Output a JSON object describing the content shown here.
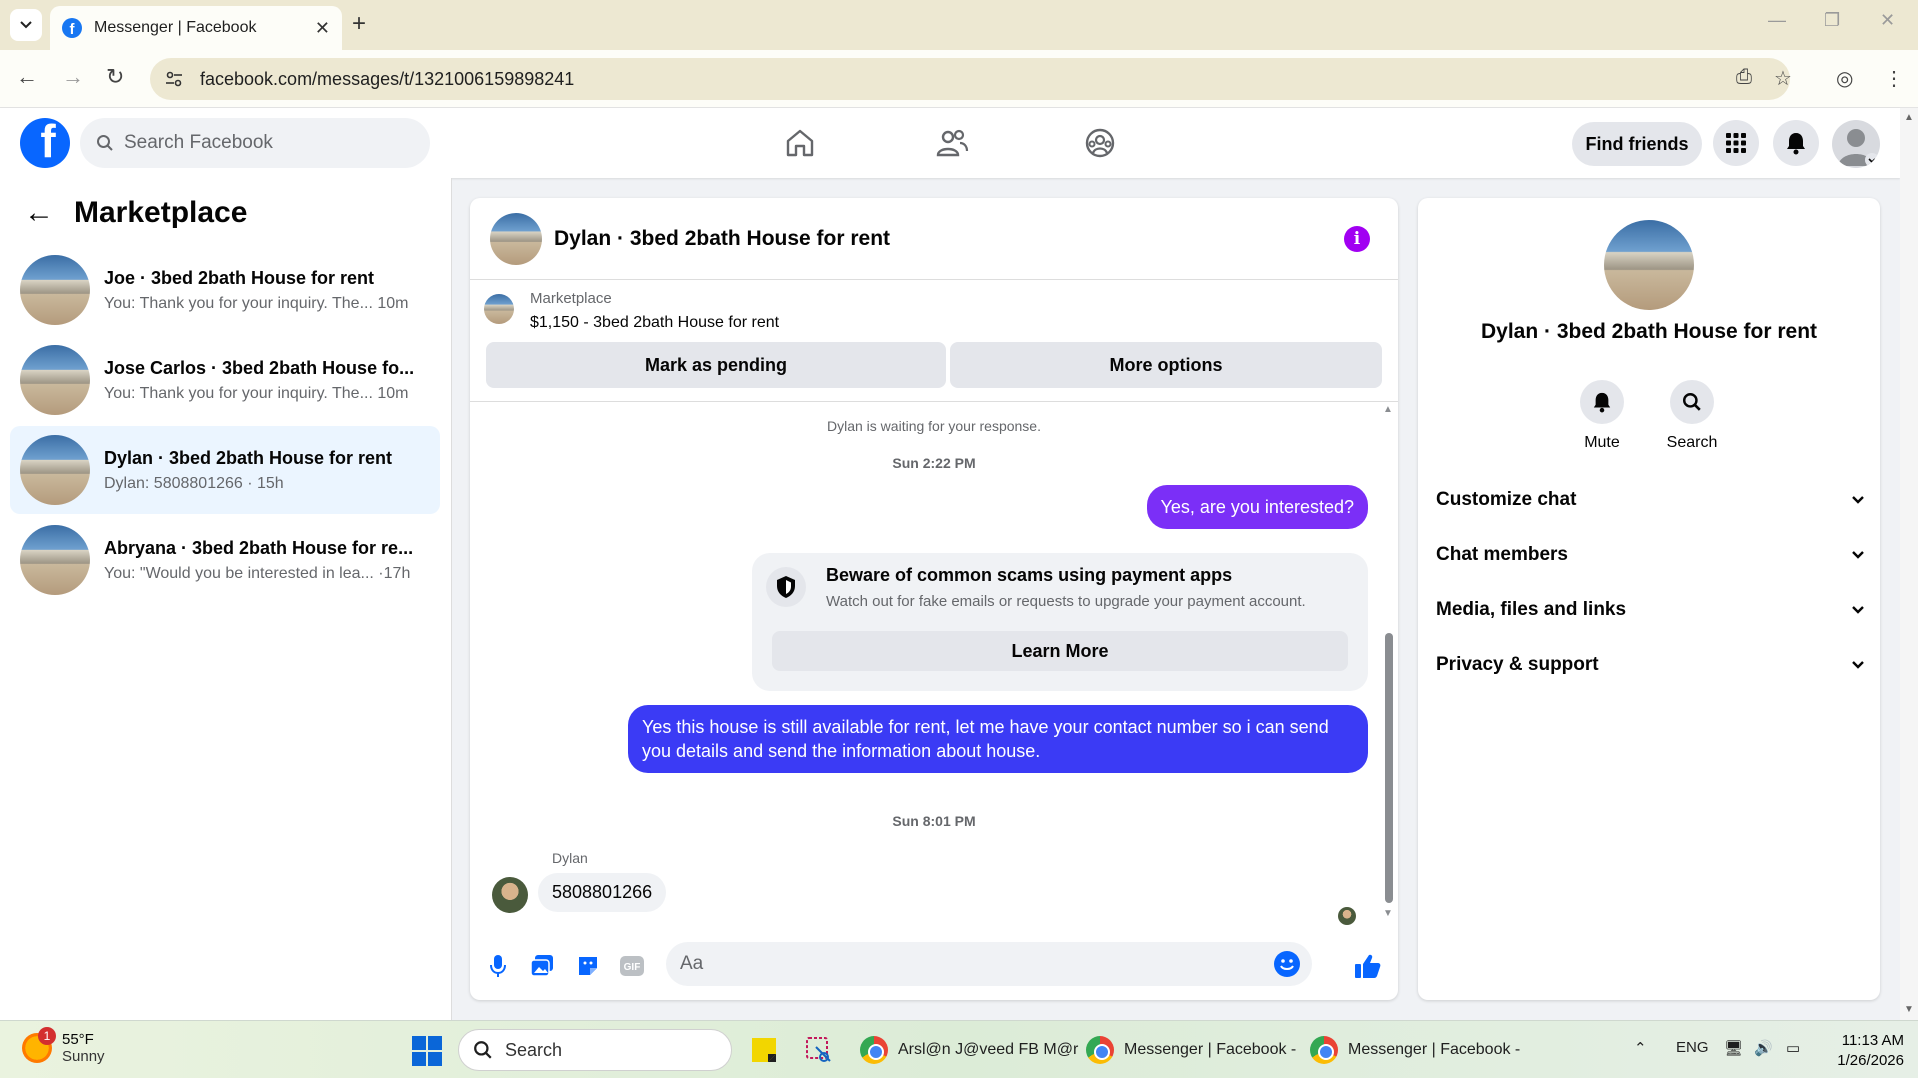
{
  "browser": {
    "tab_title": "Messenger | Facebook",
    "url": "facebook.com/messages/t/1321006159898241"
  },
  "fb_header": {
    "search_placeholder": "Search Facebook",
    "find_friends_label": "Find friends"
  },
  "left_panel": {
    "title": "Marketplace",
    "conversations": [
      {
        "name": "Joe · 3bed 2bath House for rent",
        "preview": "You: Thank you for your inquiry. The...",
        "time": "10m",
        "active": false
      },
      {
        "name": "Jose Carlos · 3bed 2bath House fo...",
        "preview": "You: Thank you for your inquiry. The...",
        "time": "10m",
        "active": false
      },
      {
        "name": "Dylan · 3bed 2bath House for rent",
        "preview": "Dylan: 5808801266",
        "time": "15h",
        "active": true
      },
      {
        "name": "Abryana · 3bed 2bath House for re...",
        "preview": "You: \"Would you be interested in lea...",
        "time": "17h",
        "active": false
      }
    ]
  },
  "chat": {
    "title": "Dylan · 3bed 2bath House for rent",
    "listing_source": "Marketplace",
    "listing_price_title": "$1,150 - 3bed 2bath House for rent",
    "mark_pending_label": "Mark as pending",
    "more_options_label": "More options",
    "waiting_text": "Dylan is waiting for your response.",
    "timestamp_1": "Sun 2:22 PM",
    "msg_out_1": "Yes, are you interested?",
    "scam_title": "Beware of common scams using payment apps",
    "scam_desc": "Watch out for fake emails or requests to upgrade your payment account.",
    "learn_more_label": "Learn More",
    "msg_out_2": "Yes this house is still available for rent, let me have your contact number so i can send you details and send the information about house.",
    "timestamp_2": "Sun 8:01 PM",
    "sender_name": "Dylan",
    "msg_in_1": "5808801266",
    "composer_placeholder": "Aa"
  },
  "right_panel": {
    "name": "Dylan · 3bed 2bath House for rent",
    "mute_label": "Mute",
    "search_label": "Search",
    "sections": [
      "Customize chat",
      "Chat members",
      "Media, files and links",
      "Privacy & support"
    ]
  },
  "taskbar": {
    "weather_badge": "1",
    "temperature": "55°F",
    "condition": "Sunny",
    "search_label": "Search",
    "app1": "Arsl@n J@veed FB M@r",
    "app2": "Messenger | Facebook -",
    "app3": "Messenger | Facebook -",
    "lang": "ENG",
    "time": "11:13 AM",
    "date": "1/26/2026"
  },
  "colors": {
    "fb_blue": "#0866ff",
    "bubble_purple": "#7b2ff7",
    "bubble_blue": "#3b3bf5",
    "active_conv_bg": "#ebf5ff"
  }
}
